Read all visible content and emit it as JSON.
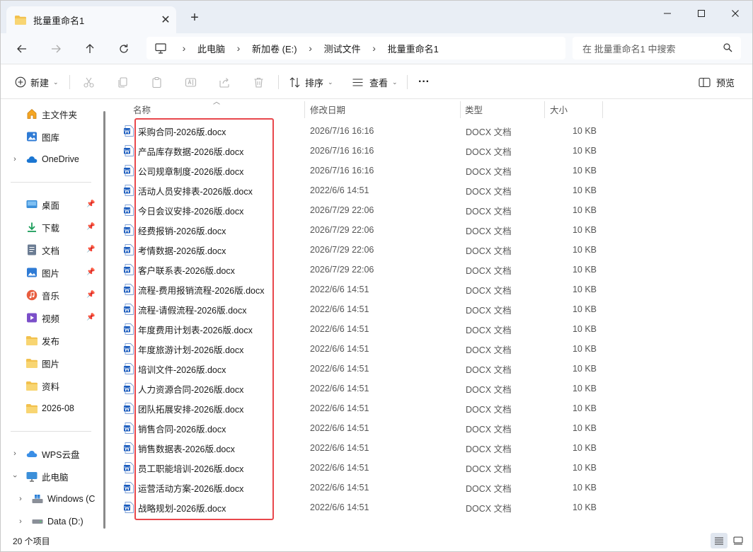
{
  "window": {
    "tab_title": "批量重命名1",
    "new_tab": "+",
    "close_tab": "✕"
  },
  "address": {
    "crumbs": [
      "此电脑",
      "新加卷 (E:)",
      "测试文件",
      "批量重命名1"
    ],
    "search_placeholder": "在 批量重命名1 中搜索"
  },
  "toolbar": {
    "new_label": "新建",
    "sort_label": "排序",
    "view_label": "查看",
    "more_label": "···",
    "preview_label": "预览"
  },
  "nav": {
    "home": "主文件夹",
    "gallery": "图库",
    "onedrive": "OneDrive",
    "quick": [
      {
        "label": "桌面",
        "icon": "desktop-icon"
      },
      {
        "label": "下载",
        "icon": "download-icon"
      },
      {
        "label": "文档",
        "icon": "document-icon"
      },
      {
        "label": "图片",
        "icon": "pictures-icon"
      },
      {
        "label": "音乐",
        "icon": "music-icon"
      },
      {
        "label": "视频",
        "icon": "video-icon"
      }
    ],
    "folders": [
      "发布",
      "图片",
      "资料",
      "2026-08"
    ],
    "wps": "WPS云盘",
    "thispc": "此电脑",
    "windows_drive": "Windows (C",
    "data_drive": "Data (D:)"
  },
  "columns": {
    "name": "名称",
    "date": "修改日期",
    "type": "类型",
    "size": "大小"
  },
  "files": [
    {
      "name": "采购合同-2026版.docx",
      "date": "2026/7/16 16:16",
      "type": "DOCX 文档",
      "size": "10 KB"
    },
    {
      "name": "产品库存数据-2026版.docx",
      "date": "2026/7/16 16:16",
      "type": "DOCX 文档",
      "size": "10 KB"
    },
    {
      "name": "公司规章制度-2026版.docx",
      "date": "2026/7/16 16:16",
      "type": "DOCX 文档",
      "size": "10 KB"
    },
    {
      "name": "活动人员安排表-2026版.docx",
      "date": "2022/6/6 14:51",
      "type": "DOCX 文档",
      "size": "10 KB"
    },
    {
      "name": "今日会议安排-2026版.docx",
      "date": "2026/7/29 22:06",
      "type": "DOCX 文档",
      "size": "10 KB"
    },
    {
      "name": "经费报销-2026版.docx",
      "date": "2026/7/29 22:06",
      "type": "DOCX 文档",
      "size": "10 KB"
    },
    {
      "name": "考情数据-2026版.docx",
      "date": "2026/7/29 22:06",
      "type": "DOCX 文档",
      "size": "10 KB"
    },
    {
      "name": "客户联系表-2026版.docx",
      "date": "2026/7/29 22:06",
      "type": "DOCX 文档",
      "size": "10 KB"
    },
    {
      "name": "流程-费用报销流程-2026版.docx",
      "date": "2022/6/6 14:51",
      "type": "DOCX 文档",
      "size": "10 KB"
    },
    {
      "name": "流程-请假流程-2026版.docx",
      "date": "2022/6/6 14:51",
      "type": "DOCX 文档",
      "size": "10 KB"
    },
    {
      "name": "年度费用计划表-2026版.docx",
      "date": "2022/6/6 14:51",
      "type": "DOCX 文档",
      "size": "10 KB"
    },
    {
      "name": "年度旅游计划-2026版.docx",
      "date": "2022/6/6 14:51",
      "type": "DOCX 文档",
      "size": "10 KB"
    },
    {
      "name": "培训文件-2026版.docx",
      "date": "2022/6/6 14:51",
      "type": "DOCX 文档",
      "size": "10 KB"
    },
    {
      "name": "人力资源合同-2026版.docx",
      "date": "2022/6/6 14:51",
      "type": "DOCX 文档",
      "size": "10 KB"
    },
    {
      "name": "团队拓展安排-2026版.docx",
      "date": "2022/6/6 14:51",
      "type": "DOCX 文档",
      "size": "10 KB"
    },
    {
      "name": "销售合同-2026版.docx",
      "date": "2022/6/6 14:51",
      "type": "DOCX 文档",
      "size": "10 KB"
    },
    {
      "name": "销售数据表-2026版.docx",
      "date": "2022/6/6 14:51",
      "type": "DOCX 文档",
      "size": "10 KB"
    },
    {
      "name": "员工职能培训-2026版.docx",
      "date": "2022/6/6 14:51",
      "type": "DOCX 文档",
      "size": "10 KB"
    },
    {
      "name": "运营活动方案-2026版.docx",
      "date": "2022/6/6 14:51",
      "type": "DOCX 文档",
      "size": "10 KB"
    },
    {
      "name": "战略规划-2026版.docx",
      "date": "2022/6/6 14:51",
      "type": "DOCX 文档",
      "size": "10 KB"
    }
  ],
  "status": {
    "count": "20 个项目"
  },
  "colors": {
    "accent": "#0067c0",
    "word_blue": "#185abd",
    "highlight_red": "#e8474c",
    "folder_yellow": "#f2c14e"
  }
}
